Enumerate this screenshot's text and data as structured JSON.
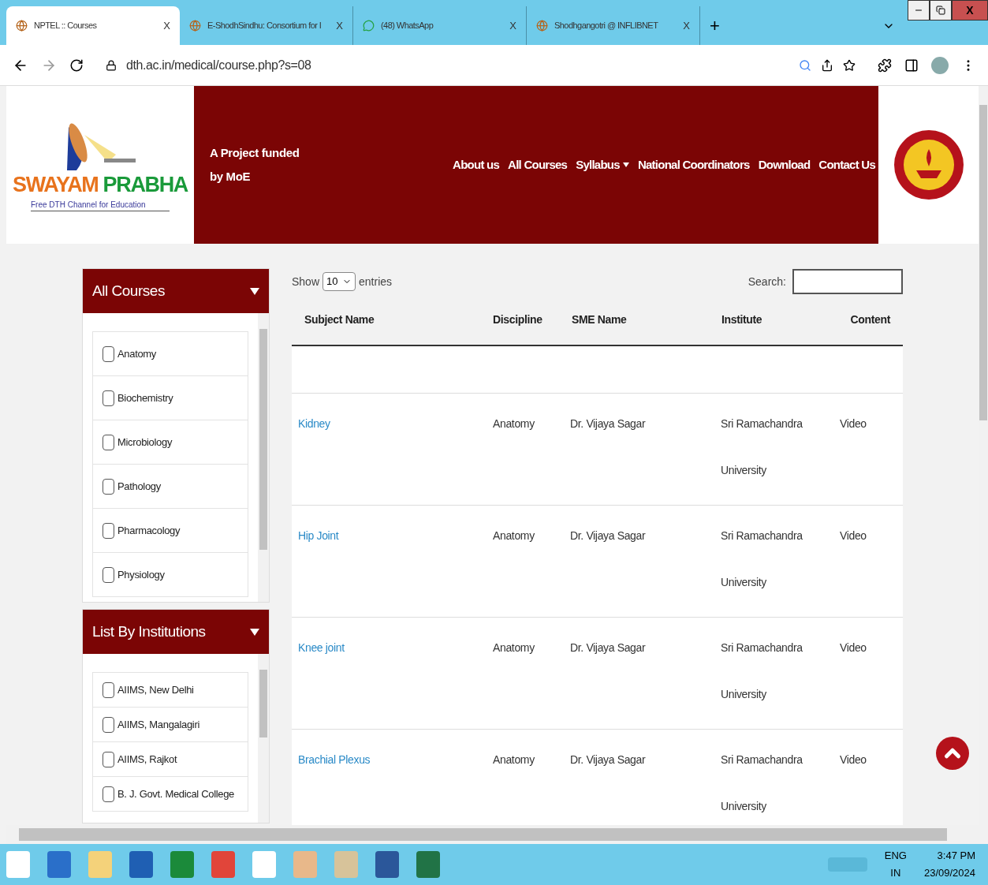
{
  "browser": {
    "tabs": [
      {
        "title": "NPTEL :: Courses",
        "selected": true,
        "close": "X"
      },
      {
        "title": "E-ShodhSindhu: Consortium for I",
        "selected": false,
        "close": "X"
      },
      {
        "title": "(48) WhatsApp",
        "selected": false,
        "close": "X"
      },
      {
        "title": "Shodhgangotri @ INFLIBNET",
        "selected": false,
        "close": "X"
      }
    ],
    "new_tab": "+",
    "window_buttons": [
      "X"
    ],
    "url": "dth.ac.in/medical/course.php?s=08"
  },
  "header": {
    "logo_title_1": "SWAYAM",
    "logo_title_2": "PRABHA",
    "logo_tagline": "Free DTH Channel for Education",
    "funding": "A Project funded by MoE",
    "nav": [
      {
        "label": "About us",
        "has_menu": false
      },
      {
        "label": "All Courses",
        "has_menu": false
      },
      {
        "label": "Syllabus",
        "has_menu": true
      },
      {
        "label": "National Coordinators",
        "has_menu": false
      },
      {
        "label": "Download",
        "has_menu": false
      },
      {
        "label": "Contact Us",
        "has_menu": false
      }
    ]
  },
  "sidebar": [
    {
      "title": "All Courses",
      "items": [
        {
          "label": "Anatomy",
          "checked": false
        },
        {
          "label": "Biochemistry",
          "checked": false
        },
        {
          "label": "Microbiology",
          "checked": false
        },
        {
          "label": "Pathology",
          "checked": false
        },
        {
          "label": "Pharmacology",
          "checked": false
        },
        {
          "label": "Physiology",
          "checked": false
        }
      ]
    },
    {
      "title": "List By Institutions",
      "items": [
        {
          "label": "AIIMS, New Delhi",
          "checked": false
        },
        {
          "label": "AIIMS, Mangalagiri",
          "checked": false
        },
        {
          "label": "AIIMS, Rajkot",
          "checked": false
        },
        {
          "label": "B. J. Govt. Medical College",
          "checked": false
        }
      ]
    }
  ],
  "table": {
    "show_label": "Show",
    "entries_value": "10",
    "entries_label": "entries",
    "search_label": "Search:",
    "columns": [
      "Subject Name",
      "Discipline",
      "SME Name",
      "Institute",
      "Content"
    ],
    "rows": [
      {
        "subject": "Kidney",
        "discipline": "Anatomy",
        "sme": "Dr. Vijaya Sagar",
        "institute_1": "Sri Ramachandra",
        "institute_2": "University",
        "content": "Video"
      },
      {
        "subject": "Hip Joint",
        "discipline": "Anatomy",
        "sme": "Dr. Vijaya Sagar",
        "institute_1": "Sri Ramachandra",
        "institute_2": "University",
        "content": "Video"
      },
      {
        "subject": "Knee joint",
        "discipline": "Anatomy",
        "sme": "Dr. Vijaya Sagar",
        "institute_1": "Sri Ramachandra",
        "institute_2": "University",
        "content": "Video"
      },
      {
        "subject": "Brachial Plexus",
        "discipline": "Anatomy",
        "sme": "Dr. Vijaya Sagar",
        "institute_1": "Sri Ramachandra",
        "institute_2": "University",
        "content": "Video"
      }
    ]
  },
  "taskbar": {
    "lang_1": "ENG",
    "lang_2": "IN",
    "time": "3:47 PM",
    "date": "23/09/2024"
  }
}
